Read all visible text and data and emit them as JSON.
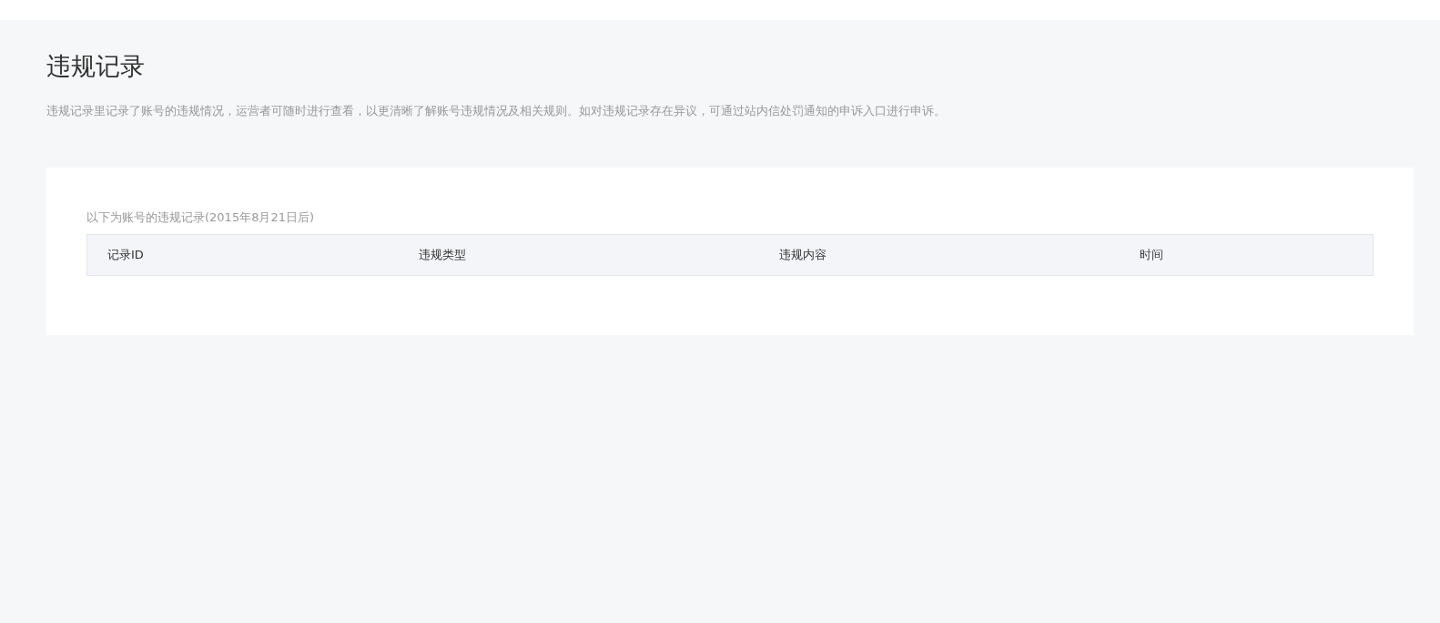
{
  "page": {
    "title": "违规记录",
    "description": "违规记录里记录了账号的违规情况，运营者可随时进行查看，以更清晰了解账号违规情况及相关规则。如对违规记录存在异议，可通过站内信处罚通知的申诉入口进行申诉。"
  },
  "records": {
    "caption": "以下为账号的违规记录(2015年8月21日后)",
    "columns": [
      "记录ID",
      "违规类型",
      "违规内容",
      "时间"
    ]
  }
}
